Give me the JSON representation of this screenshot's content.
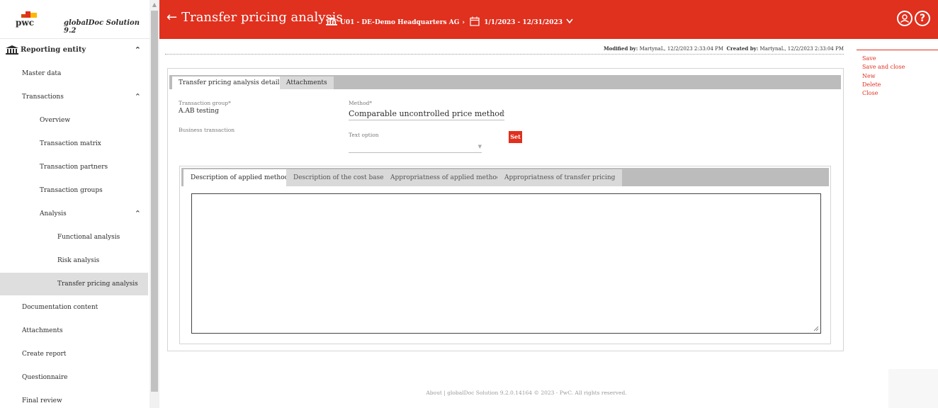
{
  "brand": {
    "logo_text": "pwc",
    "app_name": "globalDoc Solution 9.2"
  },
  "sidebar": {
    "entity": "Reporting entity",
    "items": [
      {
        "label": "Master data"
      },
      {
        "label": "Transactions"
      },
      {
        "label": "Overview"
      },
      {
        "label": "Transaction matrix"
      },
      {
        "label": "Transaction partners"
      },
      {
        "label": "Transaction groups"
      },
      {
        "label": "Analysis"
      },
      {
        "label": "Functional analysis"
      },
      {
        "label": "Risk analysis"
      },
      {
        "label": "Transfer pricing analysis"
      },
      {
        "label": "Documentation content"
      },
      {
        "label": "Attachments"
      },
      {
        "label": "Create report"
      },
      {
        "label": "Questionnaire"
      },
      {
        "label": "Final review"
      }
    ]
  },
  "header": {
    "title": "Transfer pricing analysis",
    "entity": "U01 - DE-Demo Headquarters AG",
    "period": "1/1/2023 - 12/31/2023",
    "help_glyph": "?"
  },
  "meta": {
    "modified_label": "Modified by:",
    "modified_value": "MartynaL, 12/2/2023 2:33:04 PM",
    "created_label": "Created by:",
    "created_value": "MartynaL, 12/2/2023 2:33:04 PM"
  },
  "actions": {
    "save": "Save",
    "save_close": "Save and close",
    "new": "New",
    "delete": "Delete",
    "close": "Close"
  },
  "tabs": {
    "details": "Transfer pricing analysis details",
    "attachments": "Attachments"
  },
  "form": {
    "transaction_group_label": "Transaction group*",
    "transaction_group_value": "A.AB testing",
    "business_transaction_label": "Business transaction",
    "method_label": "Method*",
    "method_value": "Comparable uncontrolled price method",
    "text_option_label": "Text option",
    "text_option_value": "",
    "set_button": "Set"
  },
  "inner_tabs": {
    "t1": "Description of applied method",
    "t2": "Description of the cost base",
    "t3": "Appropriatness of applied method",
    "t4": "Appropriatness of transfer pricing"
  },
  "footer": {
    "about": "About",
    "text": "globalDoc Solution 9.2.0.14164 © 2023 - PwC. All rights reserved."
  },
  "colors": {
    "accent": "#e0301e",
    "tab_bar": "#bcbcbc",
    "active_nav": "#dedede"
  }
}
